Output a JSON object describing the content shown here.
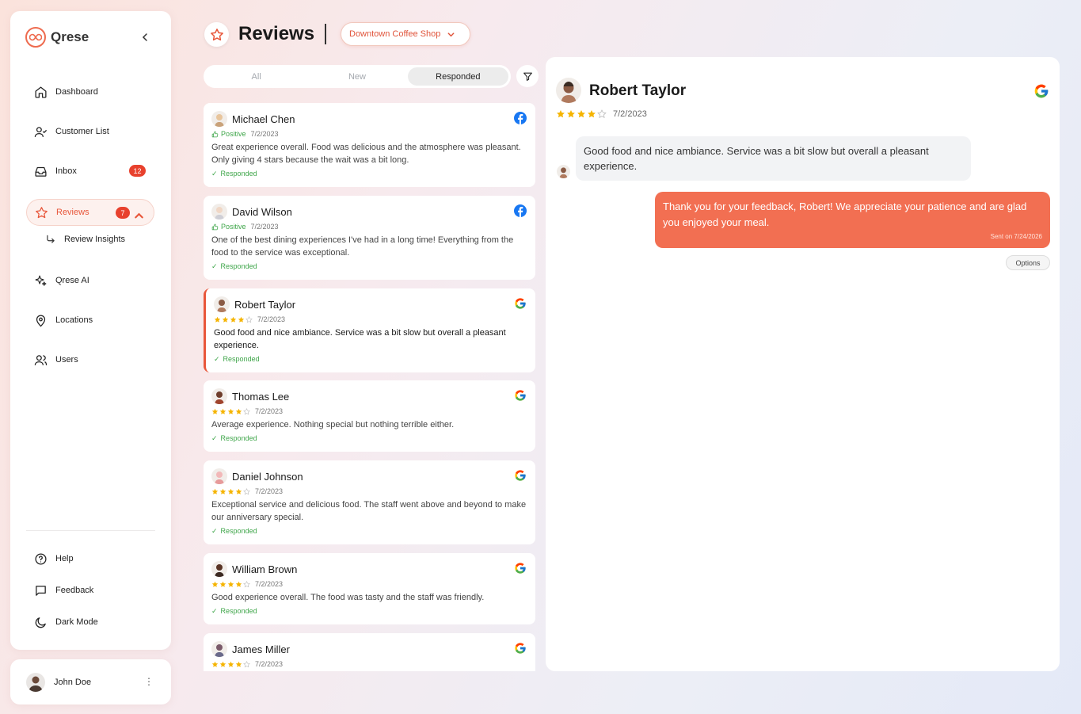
{
  "brand": {
    "name": "Qrese",
    "accent": "#e8563a"
  },
  "sidebar": {
    "items": [
      {
        "label": "Dashboard",
        "icon": "home-icon"
      },
      {
        "label": "Customer List",
        "icon": "user-check-icon"
      },
      {
        "label": "Inbox",
        "icon": "inbox-icon",
        "badge": "12"
      },
      {
        "label": "Reviews",
        "icon": "star-icon",
        "badge": "7",
        "active": true
      },
      {
        "label": "Qrese AI",
        "icon": "sparkles-icon"
      },
      {
        "label": "Locations",
        "icon": "map-pin-icon"
      },
      {
        "label": "Users",
        "icon": "users-icon"
      }
    ],
    "sub_item": {
      "label": "Review Insights",
      "icon": "corner-down-right-icon"
    },
    "bottom": [
      {
        "label": "Help",
        "icon": "help-circle-icon"
      },
      {
        "label": "Feedback",
        "icon": "message-square-icon"
      },
      {
        "label": "Dark Mode",
        "icon": "moon-icon"
      }
    ],
    "user": {
      "name": "John Doe"
    }
  },
  "header": {
    "title": "Reviews",
    "location": "Downtown Coffee Shop"
  },
  "tabs": [
    {
      "label": "All",
      "active": false
    },
    {
      "label": "New",
      "active": false
    },
    {
      "label": "Responded",
      "active": true
    }
  ],
  "reviews": [
    {
      "name": "Michael Chen",
      "source": "facebook",
      "sentiment": "Positive",
      "date": "7/2/2023",
      "text": "Great experience overall. Food was delicious and the atmosphere was pleasant. Only giving 4 stars because the wait was a bit long.",
      "status": "Responded"
    },
    {
      "name": "David Wilson",
      "source": "facebook",
      "sentiment": "Positive",
      "date": "7/2/2023",
      "text": "One of the best dining experiences I've had in a long time! Everything from the food to the service was exceptional.",
      "status": "Responded"
    },
    {
      "name": "Robert Taylor",
      "source": "google",
      "rating": 4,
      "date": "7/2/2023",
      "text": "Good food and nice ambiance. Service was a bit slow but overall a pleasant experience.",
      "status": "Responded",
      "selected": true
    },
    {
      "name": "Thomas Lee",
      "source": "google",
      "rating": 4,
      "date": "7/2/2023",
      "text": "Average experience. Nothing special but nothing terrible either.",
      "status": "Responded"
    },
    {
      "name": "Daniel Johnson",
      "source": "google",
      "rating": 4,
      "date": "7/2/2023",
      "text": "Exceptional service and delicious food. The staff went above and beyond to make our anniversary special.",
      "status": "Responded"
    },
    {
      "name": "William Brown",
      "source": "google",
      "rating": 4,
      "date": "7/2/2023",
      "text": "Good experience overall. The food was tasty and the staff was friendly.",
      "status": "Responded"
    },
    {
      "name": "James Miller",
      "source": "google",
      "rating": 4,
      "date": "7/2/2023",
      "text": "",
      "status": ""
    }
  ],
  "detail": {
    "name": "Robert Taylor",
    "rating": 4,
    "date": "7/2/2023",
    "message": "Good food and nice ambiance. Service was a bit slow but overall a pleasant experience.",
    "reply": "Thank you for your feedback, Robert! We appreciate your patience and are glad you enjoyed your meal.",
    "sent": "Sent on 7/24/2026",
    "options_label": "Options"
  }
}
